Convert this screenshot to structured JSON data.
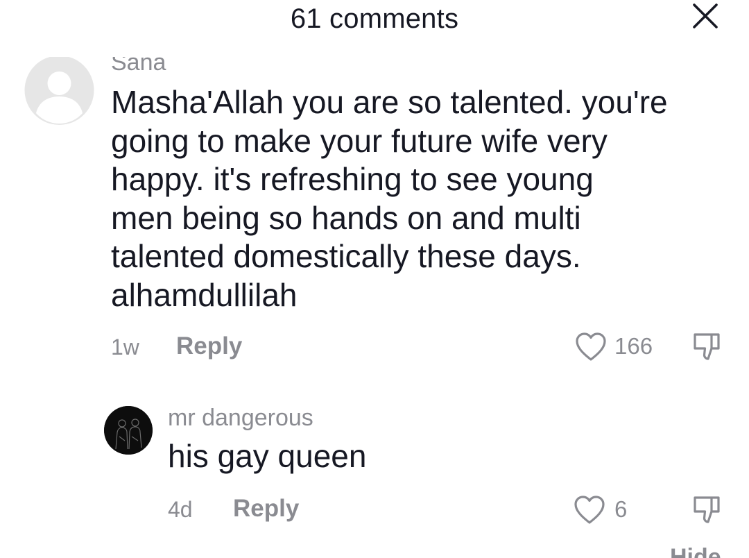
{
  "header": {
    "title": "61 comments"
  },
  "comments": [
    {
      "username": "Sana",
      "text": "Masha'Allah you are so talented. you're going to make your future wife very happy. it's refreshing to see young men being so hands on and multi talented domestically these days. alhamdullilah",
      "lines": [
        "Masha'Allah you are so talented. you're",
        "going to make your future wife very",
        "happy. it's refreshing to see young",
        "men being so hands on and multi",
        "talented domestically these days.",
        "alhamdullilah"
      ],
      "time": "1w",
      "reply_label": "Reply",
      "likes": "166",
      "avatar_icon": "default-avatar-icon"
    }
  ],
  "replies": [
    {
      "username": "mr dangerous",
      "text": "his gay queen",
      "time": "4d",
      "reply_label": "Reply",
      "likes": "6",
      "avatar_icon": "profile-photo-avatar"
    }
  ],
  "footer": {
    "hide_label": "Hide"
  },
  "colors": {
    "text_primary": "#161823",
    "text_secondary": "#8a8b91",
    "background": "#ffffff"
  }
}
